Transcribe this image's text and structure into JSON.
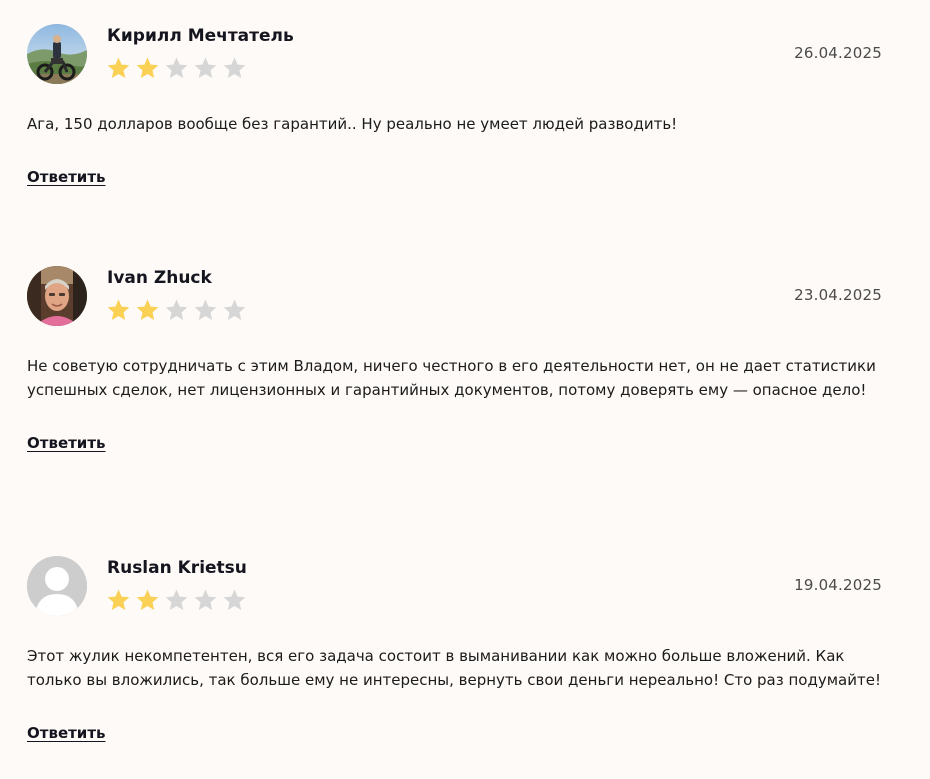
{
  "reviews": [
    {
      "author": "Кирилл Мечтатель",
      "date": "26.04.2025",
      "rating": 2,
      "max_rating": 5,
      "text": "Ага, 150 долларов вообще без гарантий.. Ну реально не умеет людей разводить!",
      "reply_label": "Ответить",
      "avatar": "photo-avatar-motorcycle"
    },
    {
      "author": "Ivan Zhuck",
      "date": "23.04.2025",
      "rating": 2,
      "max_rating": 5,
      "text": "Не советую сотрудничать с этим Владом, ничего честного в его деятельности нет, он не дает статистики успешных сделок, нет лицензионных и гарантийных документов, потому доверять ему — опасное дело!",
      "reply_label": "Ответить",
      "avatar": "photo-avatar-portrait"
    },
    {
      "author": "Ruslan Krietsu",
      "date": "19.04.2025",
      "rating": 2,
      "max_rating": 5,
      "text": "Этот жулик некомпетентен, вся его задача состоит в выманивании как можно больше вложений. Как только вы вложились, так больше ему не интересны, вернуть свои деньги нереально! Сто раз подумайте!",
      "reply_label": "Ответить",
      "avatar": "default-user-icon"
    }
  ],
  "colors": {
    "background": "#fdfaf7",
    "star_filled": "#fad055",
    "star_empty": "#d6d6d6",
    "text": "#1b1b1b",
    "date": "#4b4b4b"
  }
}
